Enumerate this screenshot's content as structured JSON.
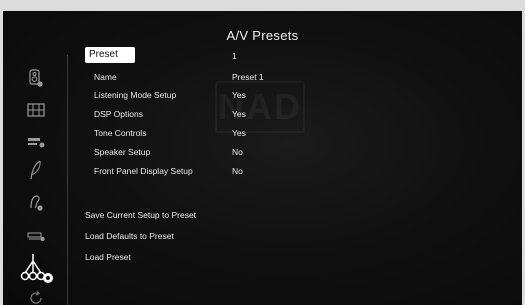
{
  "header": {
    "title": "A/V Presets"
  },
  "preset": {
    "label": "Preset",
    "value": "1"
  },
  "settings": [
    {
      "label": "Name",
      "value": "Preset 1"
    },
    {
      "label": "Listening Mode Setup",
      "value": "Yes"
    },
    {
      "label": "DSP Options",
      "value": "Yes"
    },
    {
      "label": "Tone Controls",
      "value": "Yes"
    },
    {
      "label": "Speaker Setup",
      "value": "No"
    },
    {
      "label": "Front Panel Display Setup",
      "value": "No"
    }
  ],
  "actions": [
    {
      "label": "Save Current Setup to Preset"
    },
    {
      "label": "Load Defaults to Preset"
    },
    {
      "label": "Load Preset"
    }
  ],
  "sidebar": {
    "icons": [
      "speaker-settings-icon",
      "grid-inputs-icon",
      "display-settings-icon",
      "feather-audio-icon",
      "listening-settings-icon",
      "amplifier-settings-icon",
      "av-presets-icon",
      "refresh-icon"
    ]
  },
  "colors": {
    "background": "#111111",
    "text": "#e8e8e8",
    "highlight": "#ffffff"
  }
}
